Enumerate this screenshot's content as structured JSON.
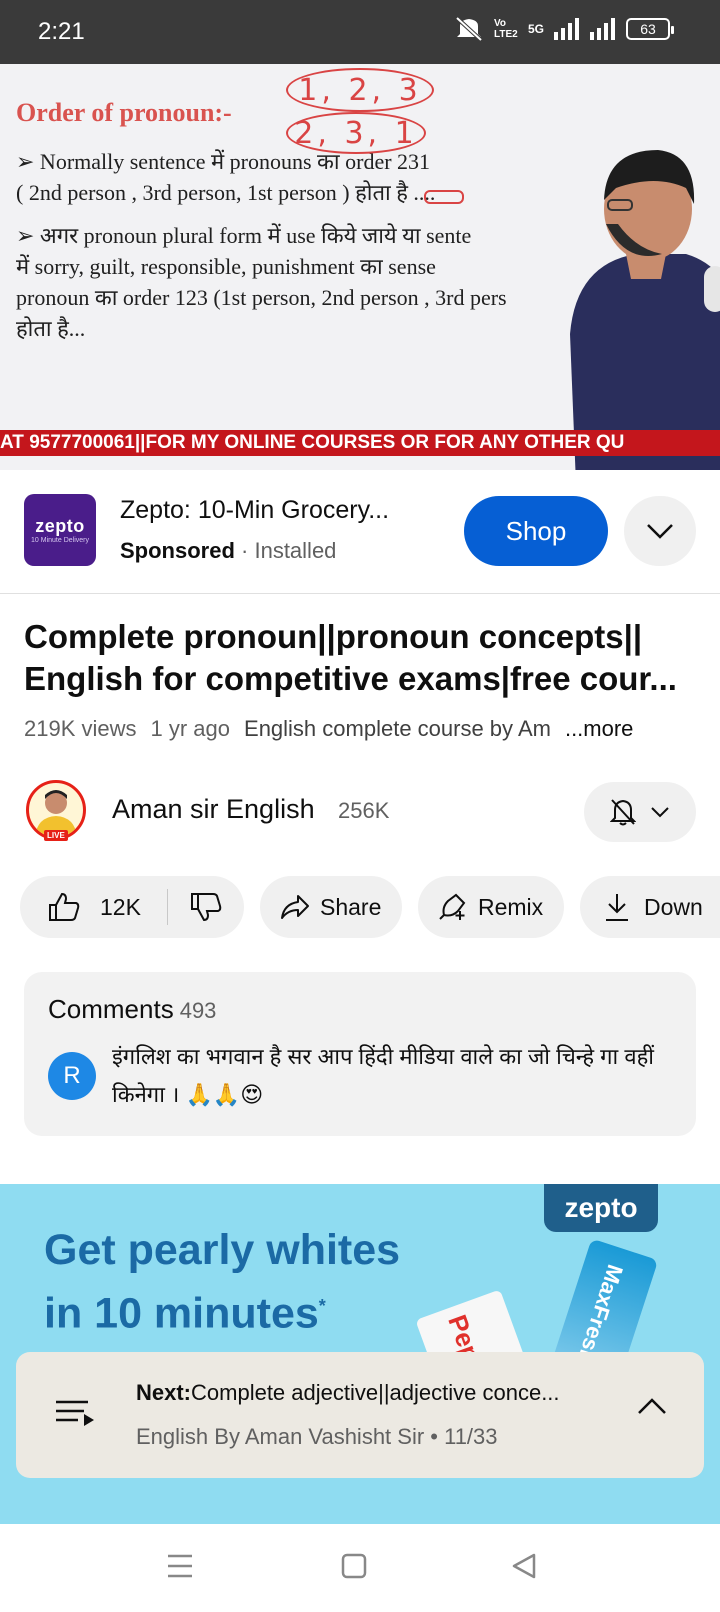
{
  "status_bar": {
    "time": "2:21",
    "volte_label": "Vo LTE2",
    "network_label": "5G",
    "battery": "63"
  },
  "video": {
    "slide_title": "Order of pronoun:-",
    "annotation_top": "1, 2, 3",
    "annotation_bottom": "2, 3, 1",
    "line1": "➢ Normally sentence में pronouns का order 231",
    "line2": "( 2nd person , 3rd person, 1st person ) होता है ....",
    "line3": "➢ अगर pronoun plural form में use किये जाये या sente",
    "line4": "में sorry, guilt, responsible, punishment का sense",
    "line5": "pronoun का order 123 (1st person, 2nd person , 3rd pers",
    "line6": "होता है...",
    "ticker": "AT 9577700061||FOR MY ONLINE COURSES OR FOR ANY OTHER QU"
  },
  "ad": {
    "logo_word": "zepto",
    "logo_sub": "10 Minute Delivery",
    "title": "Zepto: 10-Min Grocery...",
    "sponsored": "Sponsored",
    "separator": " · ",
    "status": "Installed",
    "shop_label": "Shop"
  },
  "video_info": {
    "title_line1": "Complete pronoun||pronoun concepts||",
    "title_line2": "English for competitive exams|free cour...",
    "views": "219K views",
    "age": "1 yr ago",
    "playlist": "English complete course by Am",
    "more": "...more"
  },
  "channel": {
    "name": "Aman sir English",
    "subscribers": "256K",
    "live_badge": "LIVE"
  },
  "actions": {
    "likes": "12K",
    "share": "Share",
    "remix": "Remix",
    "download": "Down"
  },
  "comments": {
    "heading": "Comments",
    "count": "493",
    "avatar_letter": "R",
    "top_comment": "इंगलिश का भगवान है सर आप हिंदी मीडिया वाले का जो चिन्हे गा वहीं किनेगा । 🙏🙏😍"
  },
  "banner": {
    "brand": "zepto",
    "line1": "Get pearly whites",
    "line2": "in 10 minutes",
    "asterisk": "*",
    "product1": "Pepsodent",
    "product2": "MaxFresh"
  },
  "next_up": {
    "prefix": "Next:",
    "title": "Complete adjective||adjective conce...",
    "subtitle": "English By Aman Vashisht Sir • 11/33"
  },
  "colors": {
    "accent_blue": "#065fd4",
    "ticker_red": "#c4161c",
    "banner_bg": "#8fdcf1",
    "slide_title": "#d9534f"
  },
  "icons": [
    "mute-icon",
    "signal-icon",
    "like-icon",
    "dislike-icon",
    "share-icon",
    "remix-icon",
    "download-icon",
    "bell-off-icon",
    "chevron-down-icon",
    "queue-icon",
    "chevron-up-icon",
    "menu-icon",
    "home-square-icon",
    "back-icon"
  ]
}
